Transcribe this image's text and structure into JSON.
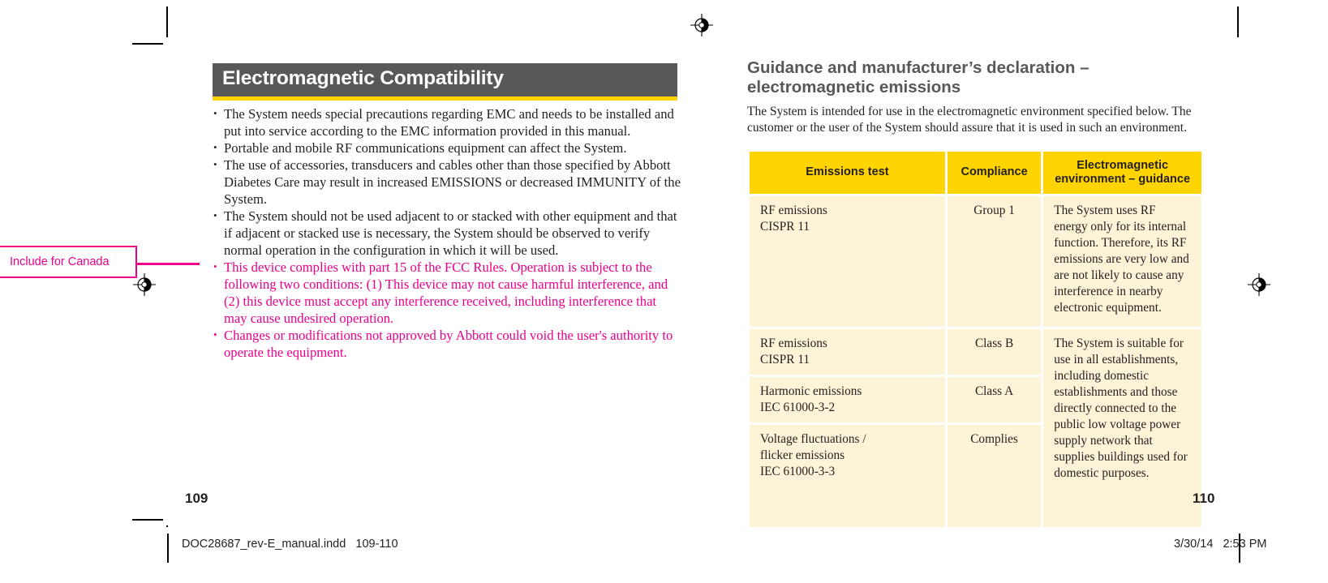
{
  "left_page": {
    "section_title": "Electromagnetic Compatibility",
    "bullets": [
      {
        "text": "The System needs special precautions regarding EMC and needs to be installed and put into service according to the EMC information provided in this manual.",
        "color": "black"
      },
      {
        "text": "Portable and mobile RF communications equipment  can affect the System.",
        "color": "black"
      },
      {
        "text": "The use of accessories, transducers and cables other than those specified by Abbott Diabetes Care may result in increased EMISSIONS or decreased IMMUNITY of the System.",
        "color": "black"
      },
      {
        "text": "The System should not be used adjacent to or stacked with other equipment  and that if adjacent or stacked  use is necessary,  the System should be observed to verify normal  operation  in the configuration  in which it will be used.",
        "color": "black"
      },
      {
        "text": "This device complies with part 15 of the FCC Rules. Operation is subject to the following two conditions: (1) This device may not cause harmful interference,  and (2) this device must accept any interference  received, including interference that may cause undesired operation.",
        "color": "magenta"
      },
      {
        "text": "Changes or modifications not approved by Abbott could void the user's authority to operate the equipment.",
        "color": "magenta"
      }
    ],
    "annotation": "Include for Canada",
    "page_number": "109"
  },
  "right_page": {
    "heading": "Guidance and manufacturer’s declaration – electromagnetic emissions",
    "intro": "The System is intended for use in the electromagnetic environment specified below. The customer or the user of the System should assure that it is used in such an environment.",
    "page_number": "110",
    "table": {
      "headers": [
        "Emissions test",
        "Compliance",
        "Electromagnetic environment – guidance"
      ],
      "rows": [
        {
          "test": "RF emissions\nCISPR 11",
          "compliance": "Group 1",
          "guidance": "The System uses RF energy only for its internal  function. Therefore, its RF emissions are very low and are not likely to cause any interference  in nearby electronic equipment."
        },
        {
          "test": "RF emissions\nCISPR 11",
          "compliance": "Class B",
          "guidance": "The System is suitable for use in all establishments,  including domestic establishments  and those directly connected  to the public low voltage power supply network that supplies buildings used for domestic  purposes."
        },
        {
          "test": "Harmonic emissions\nIEC 61000-3-2",
          "compliance": "Class A",
          "guidance": ""
        },
        {
          "test": "Voltage fluctuations /\nflicker emissions\nIEC 61000-3-3",
          "compliance": "Complies",
          "guidance": ""
        }
      ]
    }
  },
  "footer": {
    "file_label": "DOC28687_rev-E_manual.indd   109-110",
    "timestamp": "3/30/14   2:53 PM"
  },
  "colors": {
    "header_gray": "#58585b",
    "accent_yellow": "#ffd400",
    "table_cell_cream": "#fdf3d6",
    "annotation_magenta": "#ec008c",
    "body_text": "#231f20"
  }
}
